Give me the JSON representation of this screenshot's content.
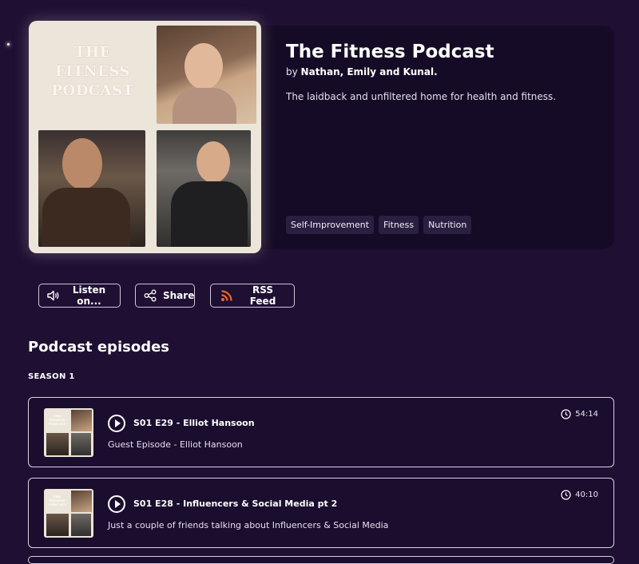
{
  "podcast": {
    "title": "The Fitness Podcast",
    "by_prefix": "by",
    "authors": "Nathan, Emily and Kunal.",
    "description": "The laidback and unfiltered home for health and fitness.",
    "cover_text": "THE FITNESS PODCAST",
    "tags": [
      "Self-Improvement",
      "Fitness",
      "Nutrition"
    ]
  },
  "actions": {
    "listen_label": "Listen on...",
    "share_label": "Share",
    "rss_label": "RSS Feed"
  },
  "episodes_section": {
    "title": "Podcast episodes",
    "season_label": "SEASON 1",
    "episodes": [
      {
        "title": "S01 E29 - Elliot Hansoon",
        "description": "Guest Episode - Elliot Hansoon",
        "duration": "54:14"
      },
      {
        "title": "S01 E28 - Influencers & Social Media pt 2",
        "description": "Just a couple of friends talking about Influencers & Social Media",
        "duration": "40:10"
      }
    ]
  },
  "icons": {
    "listen": "speaker-icon",
    "share": "share-icon",
    "rss": "rss-icon",
    "play": "play-icon",
    "duration": "clock-icon"
  },
  "colors": {
    "background": "#1e0f33",
    "card": "#150b26",
    "tag_bg": "#2a1f40",
    "rss_accent": "#f26522"
  }
}
